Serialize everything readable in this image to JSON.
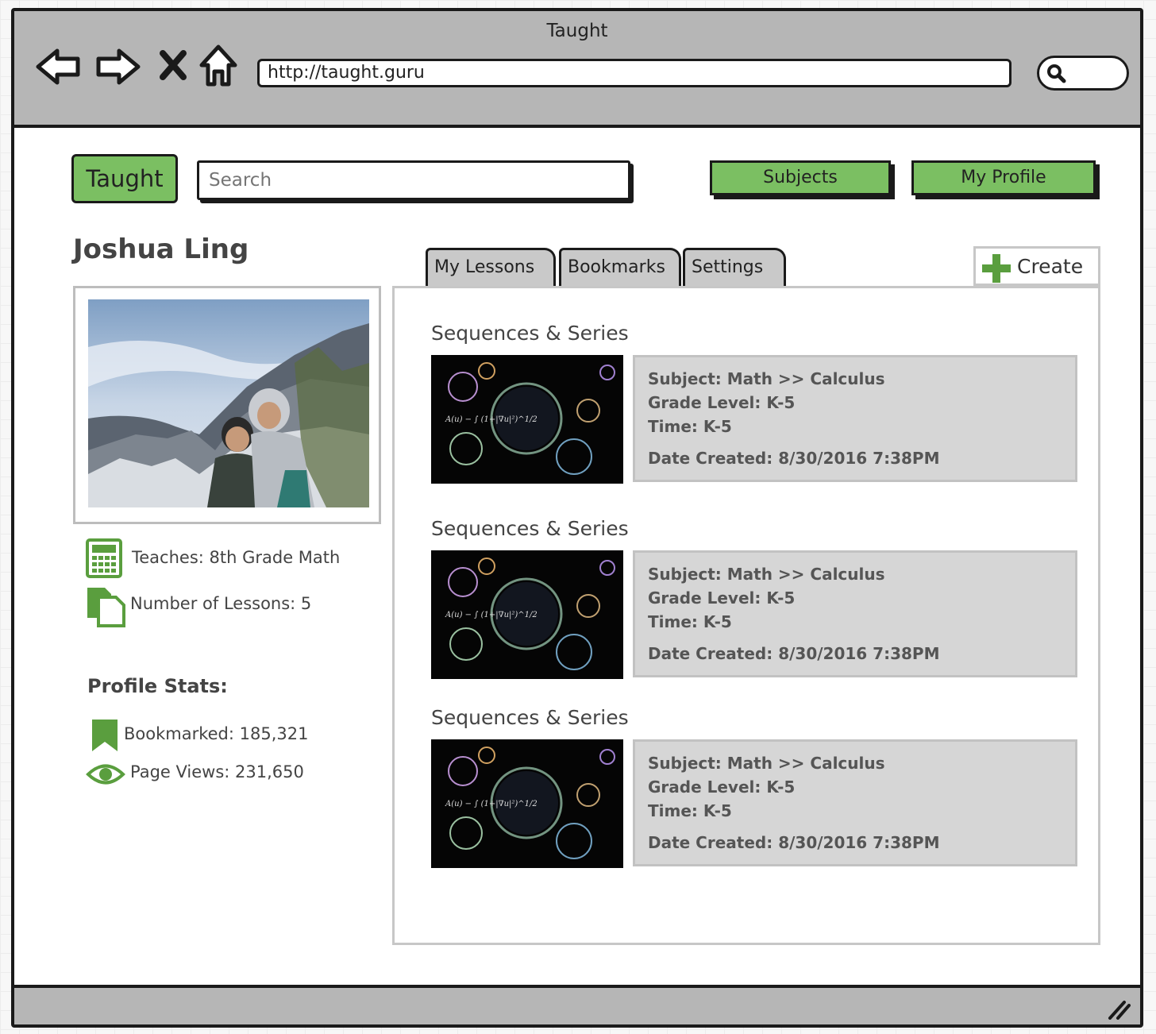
{
  "window": {
    "title": "Taught",
    "url": "http://taught.guru"
  },
  "header": {
    "logo_label": "Taught",
    "search_placeholder": "Search",
    "subjects_label": "Subjects",
    "my_profile_label": "My Profile"
  },
  "profile": {
    "name": "Joshua Ling",
    "teaches": "Teaches: 8th Grade Math",
    "num_lessons": "Number of Lessons: 5",
    "stats_title": "Profile Stats:",
    "bookmarked": "Bookmarked: 185,321",
    "page_views": "Page Views: 231,650"
  },
  "tabs": [
    {
      "label": "My Lessons"
    },
    {
      "label": "Bookmarks"
    },
    {
      "label": "Settings"
    }
  ],
  "create_label": "Create",
  "lessons": [
    {
      "title": "Sequences & Series",
      "subject": "Subject: Math >> Calculus",
      "grade": "Grade Level: K-5",
      "time": "Time: K-5",
      "date": "Date Created: 8/30/2016 7:38PM"
    },
    {
      "title": "Sequences & Series",
      "subject": "Subject: Math >> Calculus",
      "grade": "Grade Level: K-5",
      "time": "Time: K-5",
      "date": "Date Created: 8/30/2016 7:38PM"
    },
    {
      "title": "Sequences & Series",
      "subject": "Subject: Math >> Calculus",
      "grade": "Grade Level: K-5",
      "time": "Time: K-5",
      "date": "Date Created: 8/30/2016 7:38PM"
    }
  ],
  "colors": {
    "accent_green": "#7bbf62",
    "icon_green": "#5a9e3e",
    "chrome_gray": "#b6b6b6",
    "card_gray": "#d6d6d6"
  },
  "icons": [
    "back-arrow-icon",
    "forward-arrow-icon",
    "stop-icon",
    "home-icon",
    "search-icon",
    "calculator-icon",
    "documents-icon",
    "bookmark-icon",
    "eye-icon",
    "plus-icon",
    "resize-grip-icon"
  ]
}
